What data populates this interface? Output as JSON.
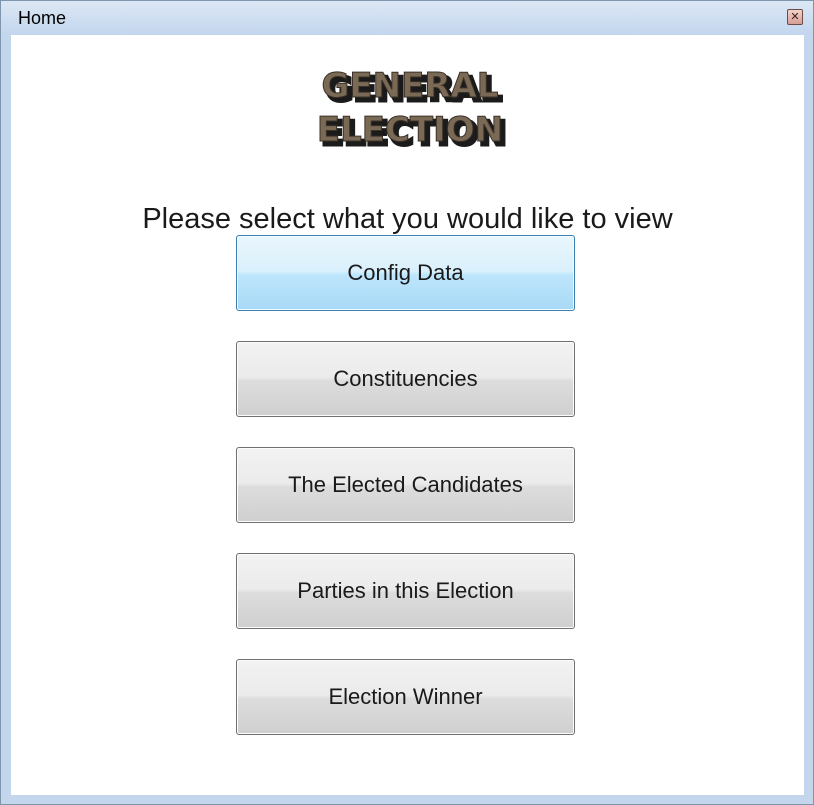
{
  "window": {
    "title": "Home",
    "close_icon": "close-icon"
  },
  "logo": {
    "line1": "GENERAL",
    "line2": "ELECTION"
  },
  "prompt": "Please select what you would like to view",
  "buttons": [
    {
      "label": "Config Data",
      "state": "hover"
    },
    {
      "label": "Constituencies",
      "state": "normal"
    },
    {
      "label": "The Elected Candidates",
      "state": "normal"
    },
    {
      "label": "Parties in this Election",
      "state": "normal"
    },
    {
      "label": "Election Winner",
      "state": "normal"
    }
  ],
  "colors": {
    "titlebar": "#c4d6ec",
    "active_button": "#bee6fd",
    "logo_fill": "#7a6a55"
  }
}
